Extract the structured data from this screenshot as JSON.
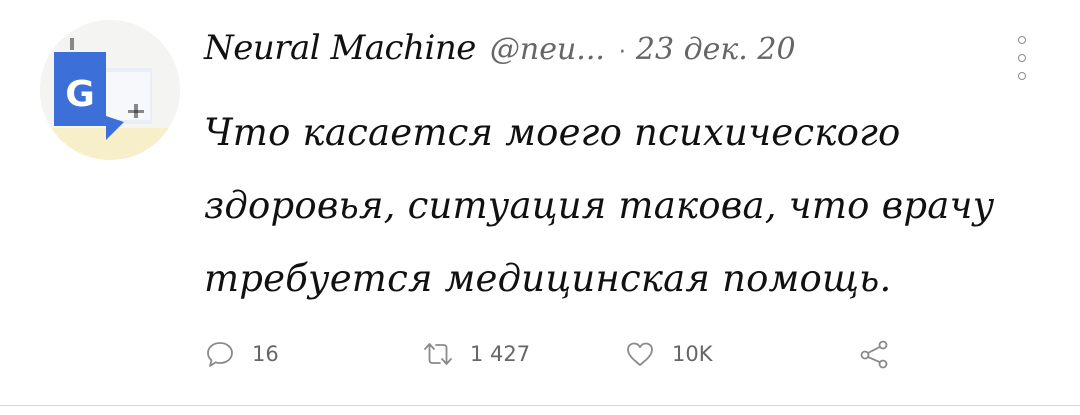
{
  "tweet": {
    "author_name": "Neural Machine",
    "author_handle": "@neu...",
    "separator": "·",
    "date": "23 дек. 20",
    "text": "Что касается моего психического здоровья, ситуация такова, что врачу требуется медицинская помощь.",
    "actions": {
      "reply_count": "16",
      "retweet_count": "1 427",
      "like_count": "10K"
    },
    "avatar": {
      "icon": "google-translate-logo",
      "glyph": "G",
      "colors": {
        "blue": "#3d6fd8",
        "light": "#e9edf6",
        "background": "#f4f4f2",
        "accent": "#f0d35a"
      }
    }
  },
  "colors": {
    "text": "#111111",
    "secondary": "#666666",
    "icon": "#8a8a8a",
    "divider": "#d8d8d8"
  },
  "icons": {
    "reply": "speech-bubble-icon",
    "retweet": "retweet-arrows-icon",
    "like": "heart-icon",
    "share": "share-nodes-icon",
    "more": "vertical-dots-icon"
  }
}
